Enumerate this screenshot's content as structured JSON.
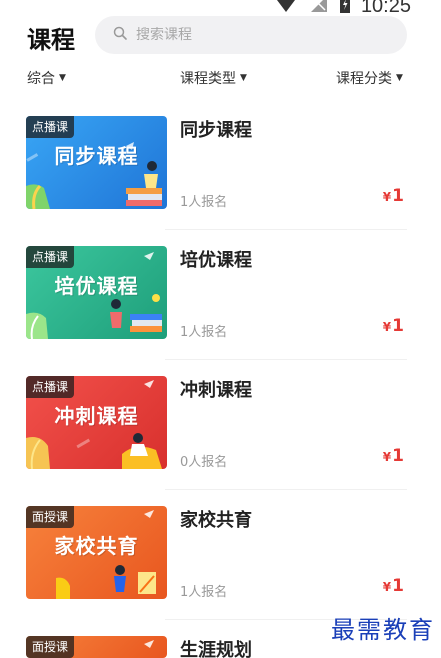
{
  "status_bar": {
    "time": "10:25"
  },
  "header": {
    "title": "课程",
    "search_placeholder": "搜索课程"
  },
  "filters": [
    {
      "label": "综合"
    },
    {
      "label": "课程类型"
    },
    {
      "label": "课程分类"
    }
  ],
  "courses": [
    {
      "tag": "点播课",
      "thumb_title": "同步课程",
      "title": "同步课程",
      "enroll": "1人报名",
      "currency": "¥",
      "price": "1",
      "theme_color": "#2b8fe6"
    },
    {
      "tag": "点播课",
      "thumb_title": "培优课程",
      "title": "培优课程",
      "enroll": "1人报名",
      "currency": "¥",
      "price": "1",
      "theme_color": "#2ab58f"
    },
    {
      "tag": "点播课",
      "thumb_title": "冲刺课程",
      "title": "冲刺课程",
      "enroll": "0人报名",
      "currency": "¥",
      "price": "1",
      "theme_color": "#e8403d"
    },
    {
      "tag": "面授课",
      "thumb_title": "家校共育",
      "title": "家校共育",
      "enroll": "1人报名",
      "currency": "¥",
      "price": "1",
      "theme_color": "#f26a2e"
    },
    {
      "tag": "面授课",
      "thumb_title": "",
      "title": "生涯规划",
      "enroll": "",
      "currency": "",
      "price": "",
      "theme_color": "#f26a2e"
    }
  ],
  "watermark": "最需教育",
  "colors": {
    "price": "#e53935",
    "search_bg": "#f1f1f3"
  }
}
